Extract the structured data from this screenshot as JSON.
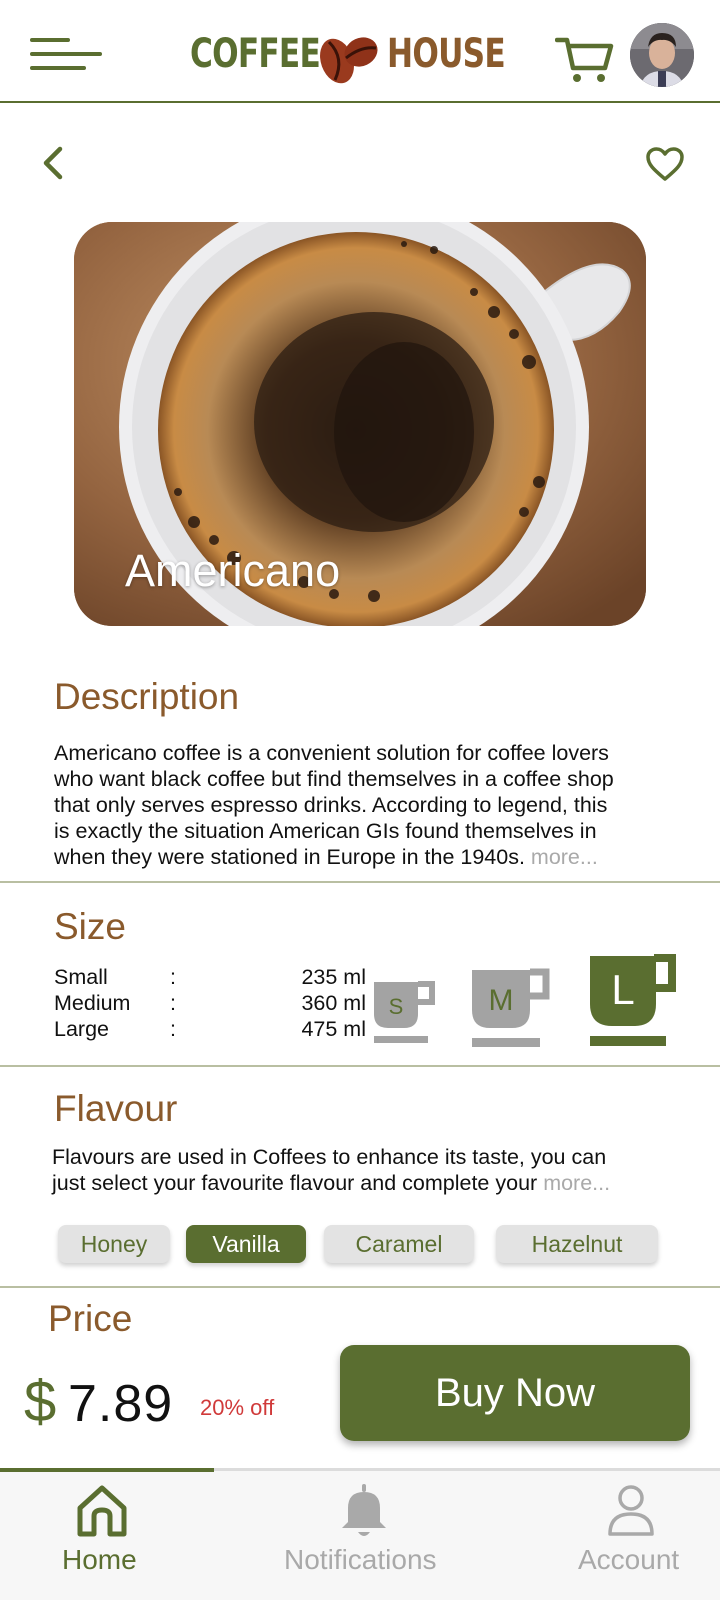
{
  "header": {
    "logo_left": "COFFEE",
    "logo_right": "HOUSE"
  },
  "product": {
    "name": "Americano"
  },
  "description": {
    "title": "Description",
    "lines": [
      "Americano coffee is a convenient solution for coffee lovers",
      "who want black coffee but find themselves in a coffee shop",
      "that only serves espresso drinks. According to legend, this",
      "is exactly the situation American GIs found themselves in",
      "when they were stationed in Europe in the 1940s."
    ],
    "more": "more..."
  },
  "size": {
    "title": "Size",
    "rows": [
      {
        "label": "Small",
        "sep": ":",
        "value": "235 ml"
      },
      {
        "label": "Medium",
        "sep": ":",
        "value": "360 ml"
      },
      {
        "label": "Large",
        "sep": ":",
        "value": "475 ml"
      }
    ],
    "cups": [
      {
        "letter": "S",
        "selected": false
      },
      {
        "letter": "M",
        "selected": false
      },
      {
        "letter": "L",
        "selected": true
      }
    ]
  },
  "flavour": {
    "title": "Flavour",
    "lines": [
      "Flavours are used in Coffees to enhance its taste, you can",
      "just select your favourite flavour and complete your"
    ],
    "more": "more...",
    "options": [
      "Honey",
      "Vanilla",
      "Caramel",
      "Hazelnut"
    ],
    "selected": "Vanilla"
  },
  "price": {
    "title": "Price",
    "currency": "$",
    "amount": "7.89",
    "discount": "20% off",
    "buy_label": "Buy Now"
  },
  "bottom_nav": {
    "items": [
      {
        "label": "Home",
        "icon": "home-icon",
        "active": true
      },
      {
        "label": "Notifications",
        "icon": "bell-icon",
        "active": false
      },
      {
        "label": "Account",
        "icon": "user-icon",
        "active": false
      }
    ]
  },
  "colors": {
    "accent_green": "#5a6e30",
    "accent_brown": "#8a5a2c",
    "discount_red": "#d03a3a",
    "muted_gray": "#a9a9a9"
  }
}
